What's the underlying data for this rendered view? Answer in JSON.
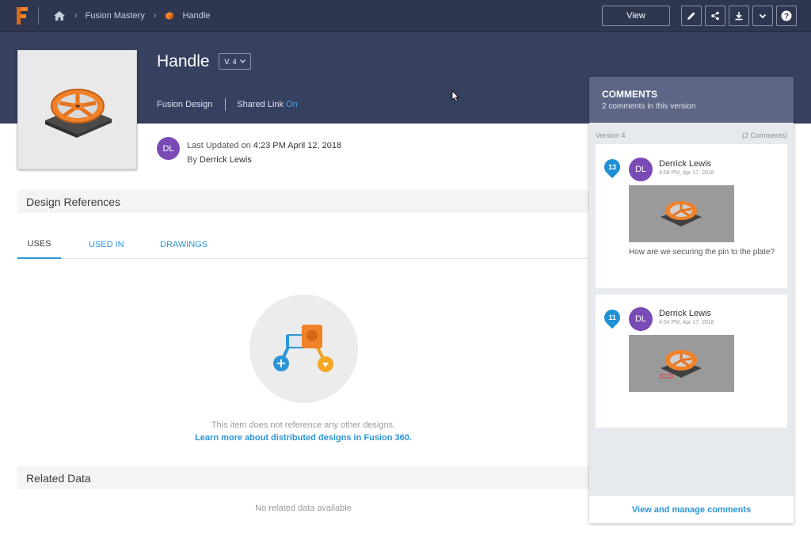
{
  "nav": {
    "breadcrumb": [
      {
        "label": "Fusion Mastery"
      },
      {
        "label": "Handle"
      }
    ],
    "view_label": "View",
    "icons": [
      "edit-icon",
      "share-icon",
      "download-icon",
      "chevron-down-icon",
      "help-icon"
    ]
  },
  "design": {
    "title": "Handle",
    "version": "V. 4",
    "type": "Fusion Design",
    "shared_link_label": "Shared Link",
    "shared_link_status": "On",
    "avatar_initials": "DL",
    "last_updated_label": "Last Updated on",
    "last_updated_value": "4:23 PM April 12, 2018",
    "by_label": "By",
    "by_value": "Derrick Lewis"
  },
  "references": {
    "heading": "Design References",
    "tabs": [
      {
        "label": "USES",
        "active": true
      },
      {
        "label": "USED IN",
        "active": false
      },
      {
        "label": "DRAWINGS",
        "active": false
      }
    ],
    "empty_text": "This item does not reference any other designs.",
    "learn_more": "Learn more about distributed designs in Fusion 360."
  },
  "related": {
    "heading": "Related Data",
    "empty_text": "No related data available"
  },
  "comments": {
    "title": "COMMENTS",
    "subtitle": "2 comments in this version",
    "version_label": "Version 4",
    "count_label": "(2 Comments)",
    "items": [
      {
        "pin": "13",
        "initials": "DL",
        "author": "Derrick Lewis",
        "time": "4:58 PM, Apr 17, 2018",
        "text": "How are we securing the pin to the plate?"
      },
      {
        "pin": "11",
        "initials": "DL",
        "author": "Derrick Lewis",
        "time": "4:54 PM, Apr 17, 2018",
        "text": ""
      }
    ],
    "footer_link": "View and manage comments"
  },
  "colors": {
    "nav_bg": "#2e3650",
    "band_bg": "#36405f",
    "accent": "#2b95d6",
    "avatar": "#7b4bb5",
    "model_orange": "#f0822a"
  }
}
